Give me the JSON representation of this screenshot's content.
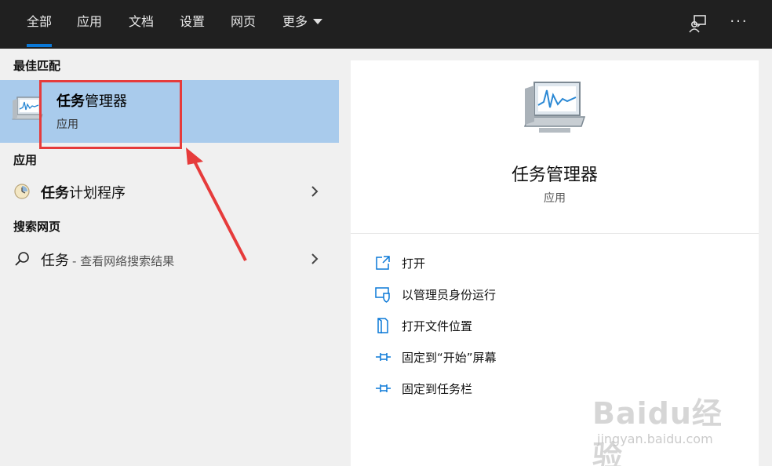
{
  "topbar": {
    "tabs": [
      {
        "label": "全部",
        "active": true
      },
      {
        "label": "应用",
        "active": false
      },
      {
        "label": "文档",
        "active": false
      },
      {
        "label": "设置",
        "active": false
      },
      {
        "label": "网页",
        "active": false
      },
      {
        "label": "更多",
        "active": false,
        "dropdown": true
      }
    ],
    "feedback_icon": "feedback-icon",
    "more_icon": "ellipsis-icon"
  },
  "left": {
    "best_match_header": "最佳匹配",
    "best_match": {
      "title_bold": "任务",
      "title_rest": "管理器",
      "subtitle": "应用",
      "icon": "task-manager-icon"
    },
    "apps_header": "应用",
    "apps": [
      {
        "title_bold": "任务",
        "title_rest": "计划程序",
        "icon": "task-scheduler-icon"
      }
    ],
    "web_header": "搜索网页",
    "web": [
      {
        "title": "任务",
        "suffix": "- 查看网络搜索结果",
        "icon": "search-icon"
      }
    ]
  },
  "right": {
    "title": "任务管理器",
    "subtitle": "应用",
    "icon": "task-manager-icon",
    "actions": [
      {
        "label": "打开",
        "icon": "open-icon"
      },
      {
        "label": "以管理员身份运行",
        "icon": "shield-icon"
      },
      {
        "label": "打开文件位置",
        "icon": "file-location-icon"
      },
      {
        "label": "固定到“开始”屏幕",
        "icon": "pin-icon"
      },
      {
        "label": "固定到任务栏",
        "icon": "pin-icon"
      }
    ]
  },
  "watermark": {
    "text": "Baidu经验",
    "url": "jingyan.baidu.com"
  },
  "colors": {
    "topbar_bg": "#202020",
    "accent": "#0a78d7",
    "selected_bg": "#a9cbec",
    "annotation_red": "#e63b3b"
  }
}
